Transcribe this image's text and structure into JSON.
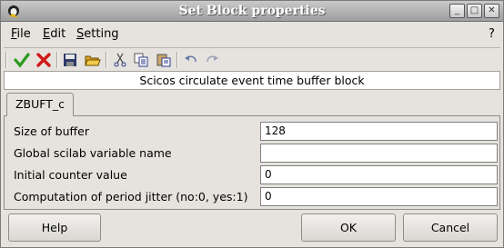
{
  "window": {
    "title": "Set Block properties",
    "controls": {
      "minimize": "_",
      "maximize": "□",
      "close": "✕"
    }
  },
  "menubar": {
    "items": [
      {
        "label": "File",
        "mnemonic": "F"
      },
      {
        "label": "Edit",
        "mnemonic": "E"
      },
      {
        "label": "Setting",
        "mnemonic": "S"
      }
    ],
    "help_label": "?"
  },
  "toolbar": {
    "icons": [
      "ok-check-icon",
      "cancel-x-icon",
      "save-icon",
      "open-folder-icon",
      "cut-icon",
      "copy-icon",
      "paste-icon",
      "undo-icon",
      "redo-icon"
    ],
    "colors": {
      "ok": "#2a9a1f",
      "cancel": "#d21a1a"
    }
  },
  "description": "Scicos circulate event time buffer block",
  "tab": {
    "label": "ZBUFT_c"
  },
  "fields": [
    {
      "label": "Size of buffer",
      "value": "128"
    },
    {
      "label": "Global scilab variable name",
      "value": ""
    },
    {
      "label": "Initial counter value",
      "value": "0"
    },
    {
      "label": "Computation of period jitter (no:0, yes:1)",
      "value": "0"
    }
  ],
  "buttons": {
    "help": "Help",
    "ok": "OK",
    "cancel": "Cancel"
  }
}
